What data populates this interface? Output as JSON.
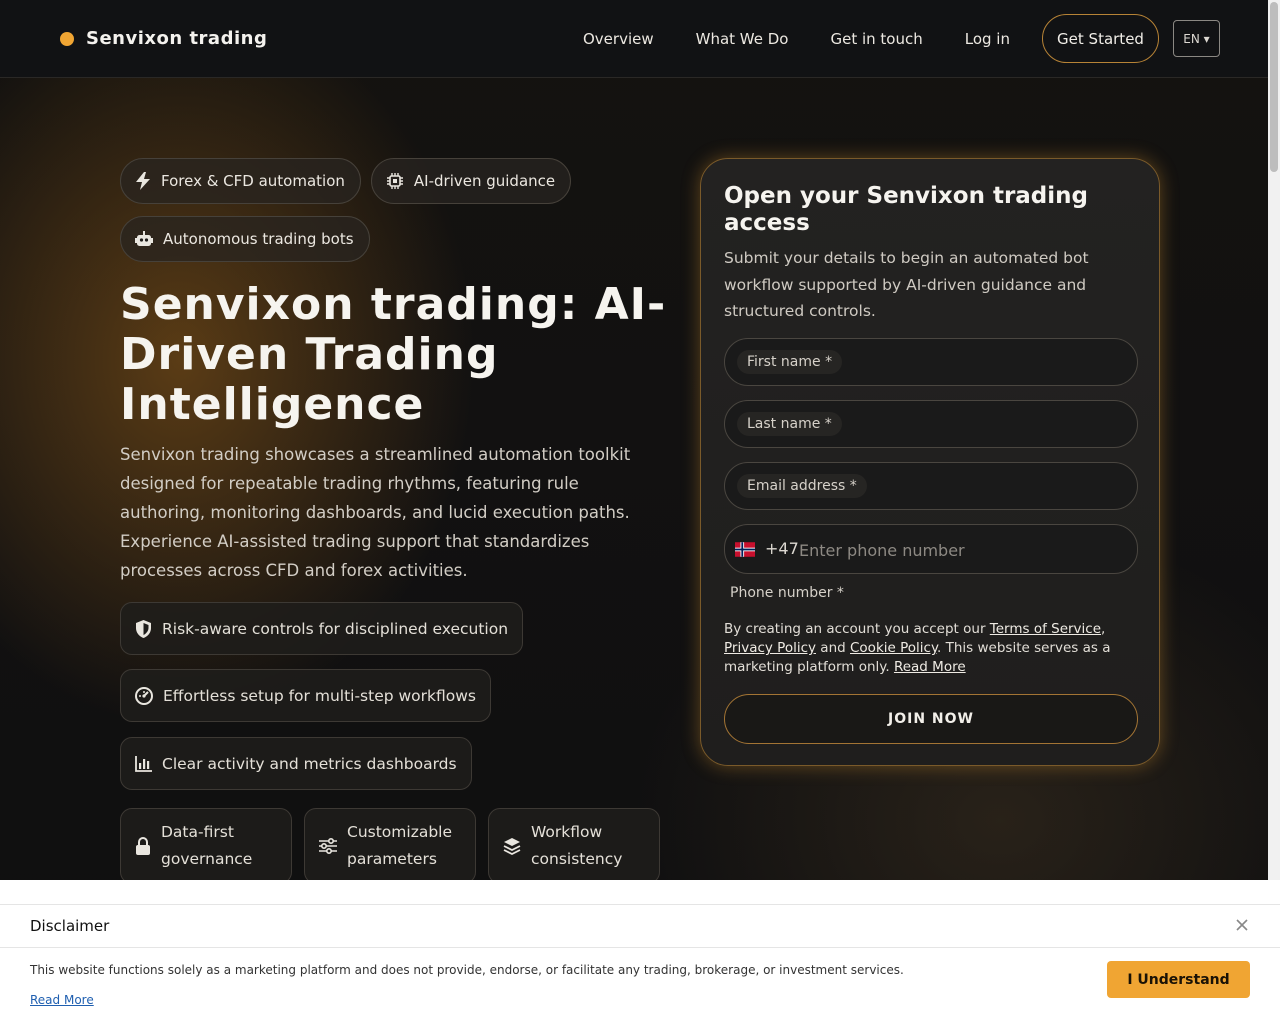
{
  "header": {
    "brand": "Senvixon trading",
    "nav": [
      "Overview",
      "What We Do",
      "Get in touch",
      "Log in"
    ],
    "cta": "Get Started",
    "lang": "EN ▾"
  },
  "hero": {
    "chips": [
      "Forex & CFD automation",
      "AI-driven guidance",
      "Autonomous trading bots"
    ],
    "title": "Senvixon trading: AI-Driven Trading Intelligence",
    "description": "Senvixon trading showcases a streamlined automation toolkit designed for repeatable trading rhythms, featuring rule authoring, monitoring dashboards, and lucid execution paths. Experience AI-assisted trading support that standardizes processes across CFD and forex activities.",
    "features": [
      "Risk-aware controls for disciplined execution",
      "Effortless setup for multi-step workflows",
      "Clear activity and metrics dashboards"
    ],
    "mini": [
      "Data-first governance",
      "Customizable parameters",
      "Workflow consistency"
    ]
  },
  "form": {
    "title": "Open your Senvixon trading access",
    "subtitle": "Submit your details to begin an automated bot workflow supported by AI-driven guidance and structured controls.",
    "first_name": "First name *",
    "last_name": "Last name *",
    "email": "Email address *",
    "phone_code": "+47",
    "phone_placeholder": "Enter phone number",
    "phone_label": "Phone number *",
    "terms_prefix": "By creating an account you accept our ",
    "terms_link": "Terms of Service",
    "terms_sep1": ", ",
    "privacy_link": "Privacy Policy",
    "terms_and": " and ",
    "cookie_link": "Cookie Policy",
    "terms_suffix": ". This website serves as a marketing platform only. ",
    "read_more": "Read More",
    "submit": "JOIN NOW"
  },
  "disclaimer": {
    "title": "Disclaimer",
    "text": "This website functions solely as a marketing platform and does not provide, endorse, or facilitate any trading, brokerage, or investment services.",
    "link": "Read More",
    "button": "I Understand"
  },
  "colors": {
    "accent": "#f0a533",
    "background": "#111214",
    "link": "#1f5fb0"
  },
  "icons": [
    "bolt-icon",
    "chip-icon",
    "robot-icon",
    "shield-icon",
    "gauge-icon",
    "bar-chart-icon",
    "lock-icon",
    "sliders-icon",
    "layers-icon",
    "norway-flag-icon",
    "close-icon"
  ]
}
